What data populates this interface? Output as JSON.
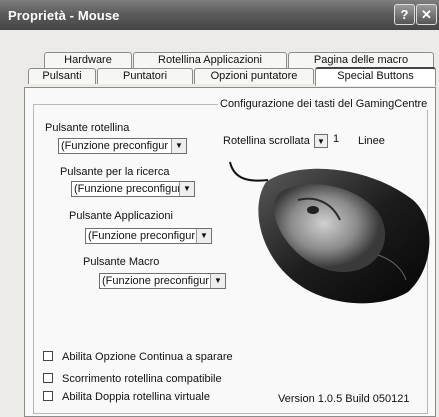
{
  "window": {
    "title": "Proprietà - Mouse",
    "help_label": "?",
    "close_label": "✕"
  },
  "tabs": {
    "row1": [
      "Hardware",
      "Rotellina Applicazioni",
      "Pagina delle macro"
    ],
    "row2": [
      "Pulsanti",
      "Puntatori",
      "Opzioni puntatore",
      "Special Buttons"
    ],
    "active": "Special Buttons"
  },
  "group": {
    "title": "Configurazione dei tasti del GamingCentre"
  },
  "buttons": [
    {
      "label": "Pulsante rotellina",
      "value": "(Funzione preconfigur"
    },
    {
      "label": "Pulsante per la ricerca",
      "value": "(Funzione preconfigur"
    },
    {
      "label": "Pulsante Applicazioni",
      "value": "(Funzione preconfigur"
    },
    {
      "label": "Pulsante Macro",
      "value": "(Funzione preconfigur"
    }
  ],
  "scroll": {
    "label": "Rotellina scrollata",
    "value": "1",
    "unit": "Linee"
  },
  "options": [
    {
      "label": "Abilita Opzione Continua a sparare",
      "checked": false
    },
    {
      "label": "Scorrimento rotellina compatibile",
      "checked": false
    },
    {
      "label": "Abilita Doppia rotellina virtuale",
      "checked": false
    }
  ],
  "version": "Version 1.0.5 Build 050121",
  "icons": {
    "dropdown": "chevron-down-icon",
    "mouse": "mouse-image"
  }
}
